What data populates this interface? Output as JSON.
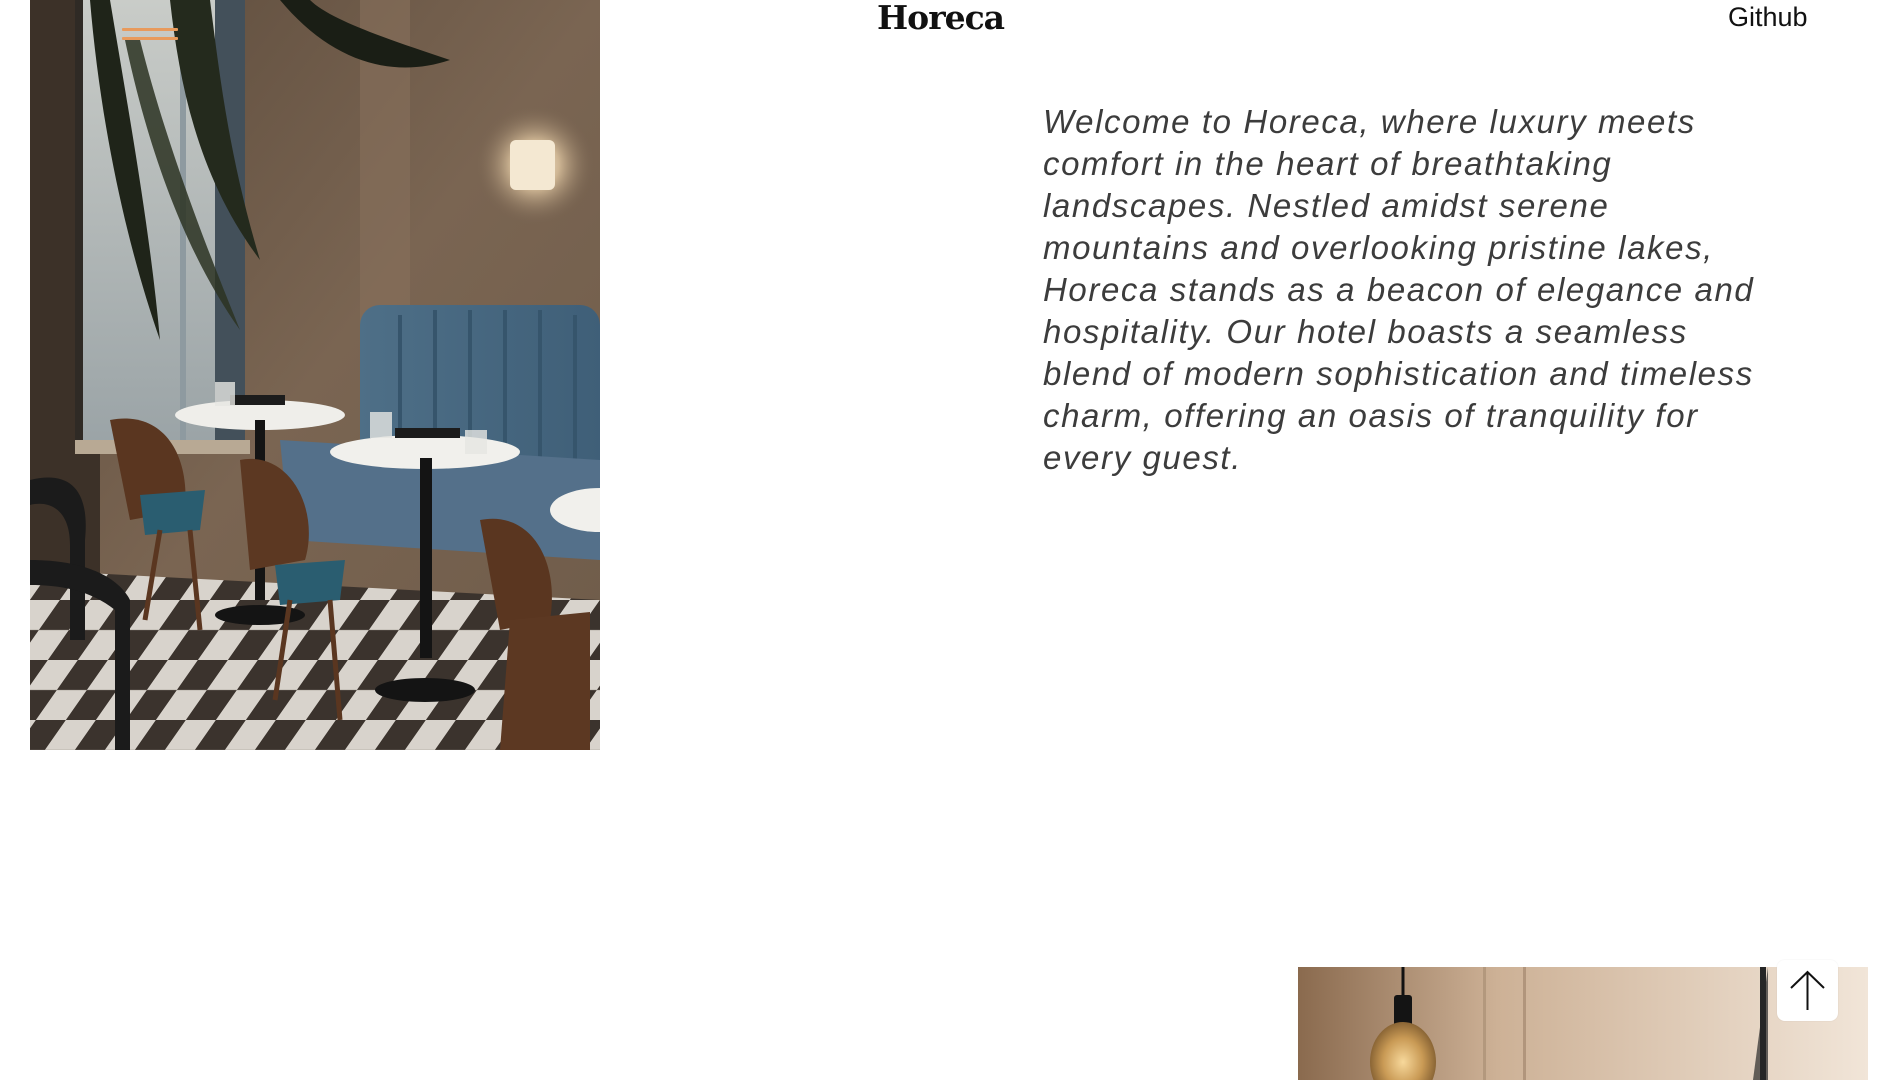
{
  "header": {
    "logo_text": "Horeca",
    "github_label": "Github",
    "menu_icon": "hamburger-menu-icon"
  },
  "intro": {
    "text": "Welcome to Horeca, where luxury meets comfort in the heart of breathtaking landscapes. Nestled amidst serene mountains and overlooking pristine lakes, Horeca stands as a beacon of elegance and hospitality. Our hotel boasts a seamless blend of modern sophistication and timeless charm, offering an oasis of tranquility for every guest."
  },
  "scroll_top": {
    "icon": "arrow-up-icon"
  },
  "colors": {
    "menu_accent": "#e89a5c",
    "text_primary": "#111111",
    "text_body": "#3c3c3c",
    "background": "#ffffff"
  }
}
